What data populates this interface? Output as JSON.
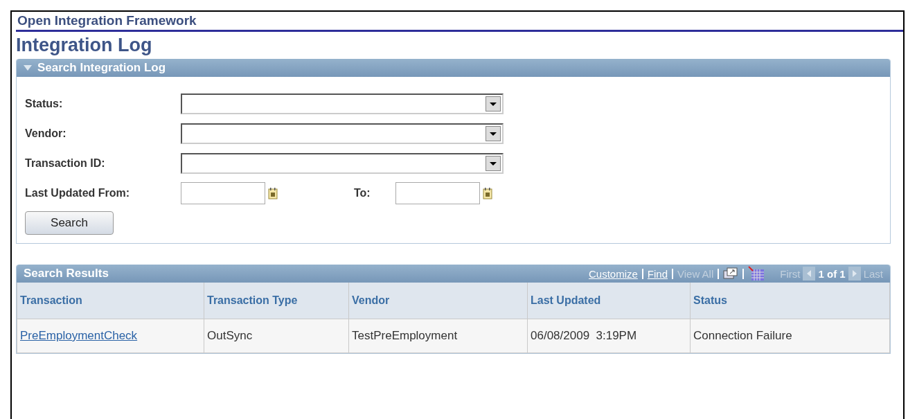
{
  "header": {
    "title": "Open Integration Framework"
  },
  "page_title": "Integration Log",
  "search_panel": {
    "title": "Search Integration Log",
    "expanded": true,
    "fields": [
      {
        "label": "Status:"
      },
      {
        "label": "Vendor:"
      },
      {
        "label": "Transaction ID:"
      }
    ],
    "date_range": {
      "from_label": "Last Updated From:",
      "to_label": "To:"
    },
    "search_button": "Search"
  },
  "results": {
    "title": "Search Results",
    "toolbar": {
      "customize": {
        "label": "Customize",
        "disabled": false
      },
      "find": {
        "label": "Find",
        "disabled": false
      },
      "view_all": {
        "label": "View All",
        "disabled": true
      },
      "first": {
        "label": "First",
        "disabled": true
      },
      "page_info": "1 of 1",
      "last": {
        "label": "Last",
        "disabled": true
      }
    },
    "columns": [
      "Transaction",
      "Transaction Type",
      "Vendor",
      "Last Updated",
      "Status"
    ],
    "rows": [
      {
        "cells": [
          "PreEmploymentCheck",
          "OutSync",
          "TestPreEmployment",
          "06/08/2009  3:19PM",
          "Connection Failure"
        ]
      }
    ]
  }
}
